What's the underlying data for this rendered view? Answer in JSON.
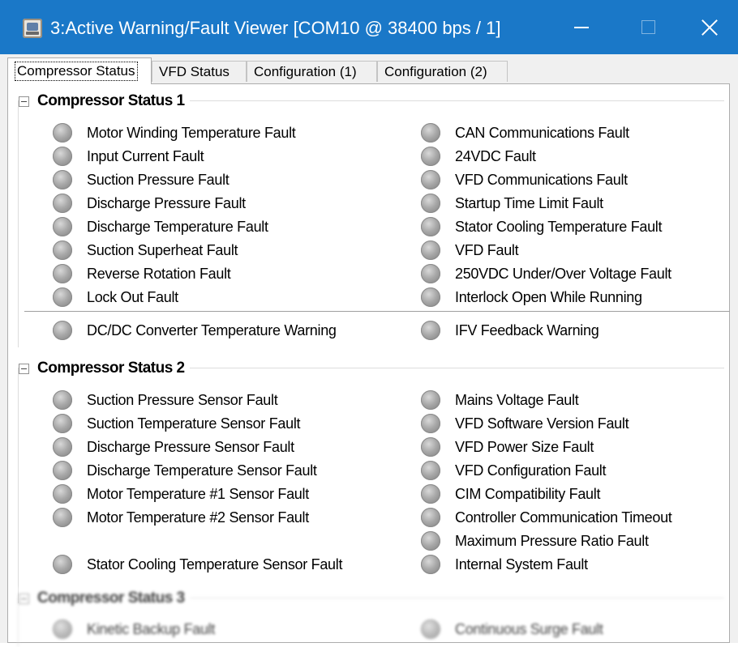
{
  "window": {
    "title": "3:Active Warning/Fault Viewer [COM10 @ 38400 bps / 1]"
  },
  "tabs": [
    {
      "label": "Compressor Status"
    },
    {
      "label": "VFD Status"
    },
    {
      "label": "Configuration (1)"
    },
    {
      "label": "Configuration (2)"
    }
  ],
  "groups": [
    {
      "title": "Compressor Status 1",
      "left_items": [
        "Motor Winding Temperature Fault",
        "Input Current Fault",
        "Suction Pressure Fault",
        "Discharge Pressure Fault",
        "Discharge Temperature Fault",
        "Suction Superheat Fault",
        "Reverse Rotation Fault",
        "Lock Out Fault"
      ],
      "right_items": [
        "CAN Communications Fault",
        "24VDC Fault",
        "VFD Communications Fault",
        "Startup Time Limit Fault",
        "Stator Cooling Temperature Fault",
        "VFD Fault",
        "250VDC Under/Over Voltage Fault",
        "Interlock Open While Running"
      ],
      "warnings": [
        "DC/DC Converter Temperature Warning",
        "IFV Feedback Warning"
      ]
    },
    {
      "title": "Compressor Status 2",
      "left_items": [
        "Suction Pressure Sensor Fault",
        "Suction Temperature Sensor Fault",
        "Discharge Pressure Sensor Fault",
        "Discharge Temperature Sensor Fault",
        "Motor Temperature #1 Sensor Fault",
        "Motor Temperature #2 Sensor Fault",
        "Stator Cooling Temperature Sensor Fault"
      ],
      "right_items": [
        "Mains Voltage Fault",
        "VFD Software Version Fault",
        "VFD Power Size Fault",
        "VFD Configuration Fault",
        "CIM Compatibility Fault",
        "Controller Communication Timeout",
        "Maximum Pressure Ratio Fault",
        "Internal System Fault"
      ]
    },
    {
      "title": "Compressor Status 3",
      "left_items": [
        "Kinetic Backup Fault"
      ],
      "right_items": [
        "Continuous Surge Fault"
      ]
    }
  ],
  "colors": {
    "titlebar": "#1a78c8",
    "led_off": "#a9a9a9"
  }
}
